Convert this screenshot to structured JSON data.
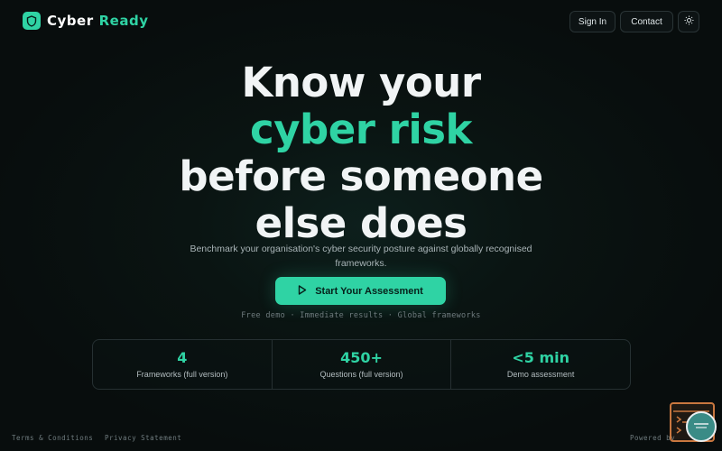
{
  "brand": {
    "name_part1": "Cyber",
    "name_part2": "Ready",
    "accent": "#2fd3a4",
    "icon": "shield-icon"
  },
  "nav": {
    "sign_in": "Sign In",
    "contact": "Contact",
    "theme_icon": "sun-icon"
  },
  "hero": {
    "line1": "Know your",
    "line2": "cyber risk",
    "line3": "before someone",
    "line4": "else does",
    "subtitle": "Benchmark your organisation's cyber security posture against globally recognised frameworks.",
    "cta_label": "Start Your Assessment",
    "cta_icon": "play-icon",
    "note": "Free demo · Immediate results · Global frameworks"
  },
  "stats": [
    {
      "value": "4",
      "label": "Frameworks (full version)"
    },
    {
      "value": "450+",
      "label": "Questions (full version)"
    },
    {
      "value": "<5 min",
      "label": "Demo assessment"
    }
  ],
  "footer": {
    "terms": "Terms & Conditions",
    "privacy": "Privacy Statement",
    "powered": "Powered by"
  }
}
